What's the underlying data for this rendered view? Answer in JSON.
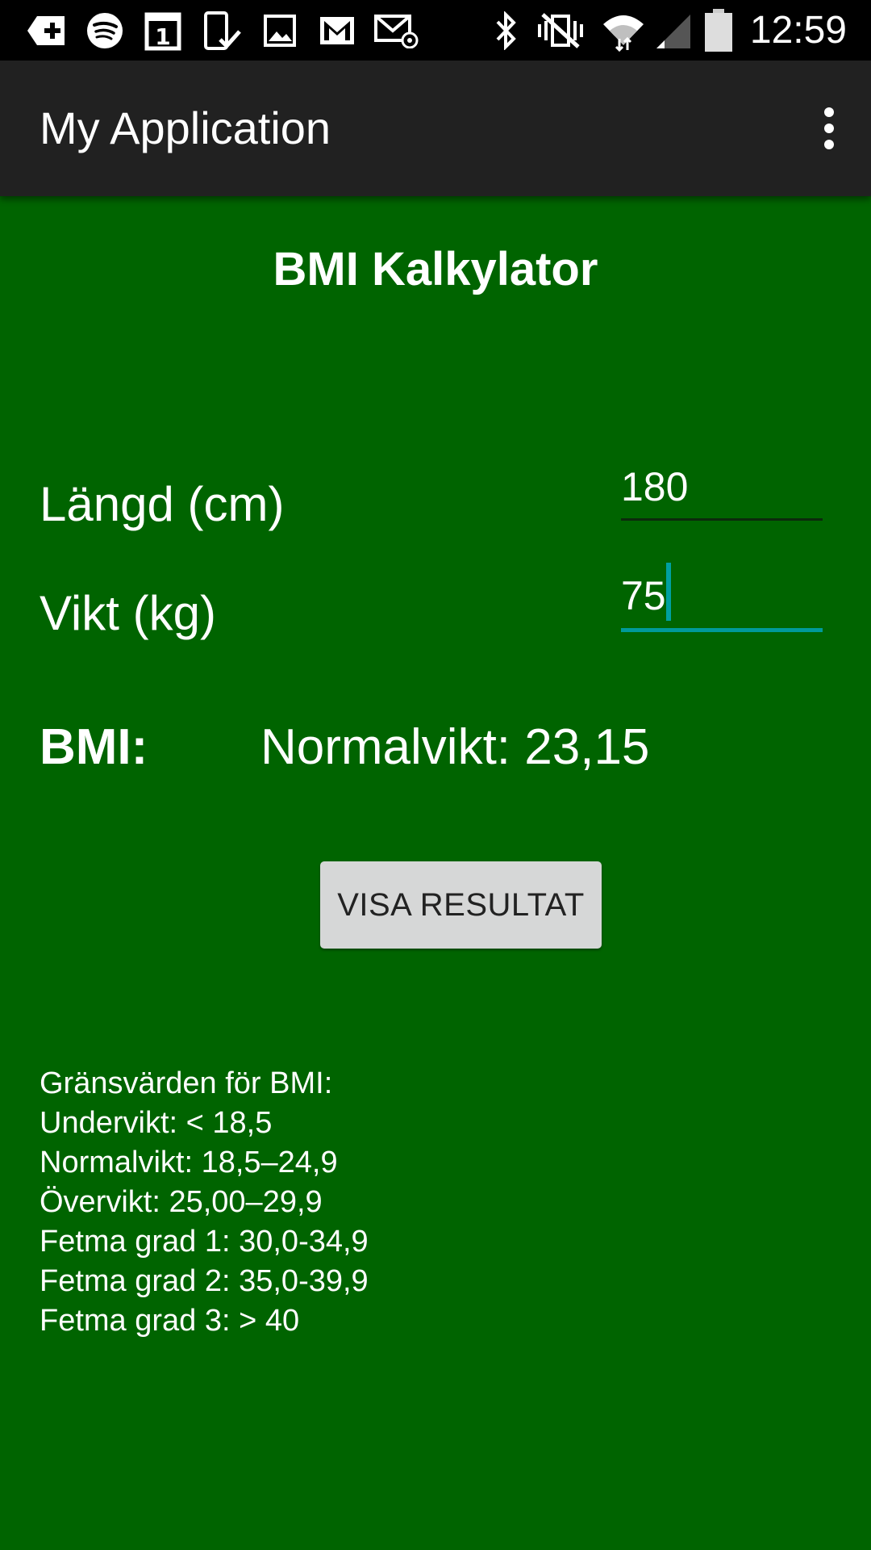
{
  "status_bar": {
    "time": "12:59",
    "icons": [
      "add-icon",
      "spotify-icon",
      "calendar-icon",
      "phone-check-icon",
      "image-icon",
      "gmail-icon",
      "email-icon",
      "bluetooth-icon",
      "vibrate-silent-icon",
      "wifi-icon",
      "signal-icon",
      "battery-icon"
    ],
    "calendar_day": "1"
  },
  "app_bar": {
    "title": "My Application",
    "overflow_icon": "more-vert-icon"
  },
  "main": {
    "heading": "BMI Kalkylator",
    "height_label": "Längd (cm)",
    "height_value": "180",
    "weight_label": "Vikt (kg)",
    "weight_value": "75",
    "bmi_label": "BMI:",
    "bmi_result": "Normalvikt: 23,15",
    "show_button": "VISA RESULTAT",
    "limits": [
      "Gränsvärden för BMI:",
      "Undervikt: < 18,5",
      "Normalvikt: 18,5–24,9",
      "Övervikt: 25,00–29,9",
      "Fetma grad 1: 30,0-34,9",
      "Fetma grad 2: 35,0-39,9",
      "Fetma grad 3: > 40"
    ]
  },
  "colors": {
    "background": "#006400",
    "app_bar": "#212121",
    "status_bar": "#000000",
    "accent": "#009a9a",
    "button": "#d6d7d7"
  }
}
